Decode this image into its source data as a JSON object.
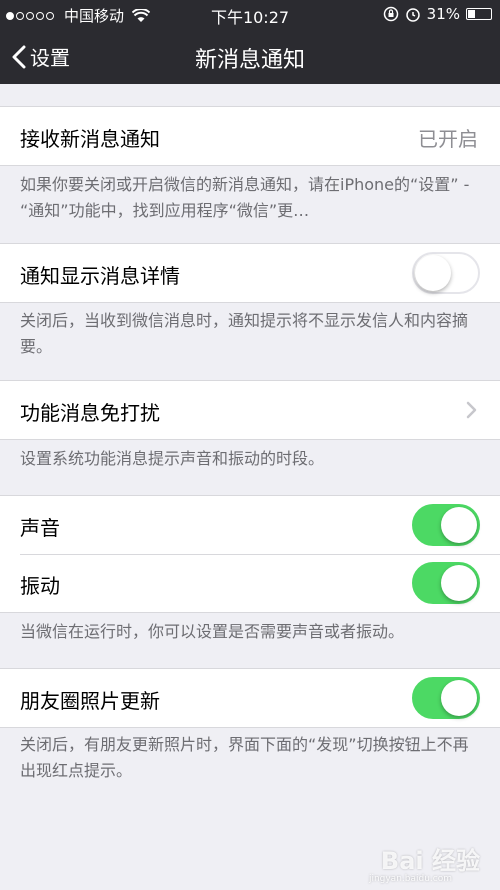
{
  "status_bar": {
    "carrier": "中国移动",
    "time": "下午10:27",
    "battery": "31%",
    "battery_level": 0.31,
    "icons": [
      "signal-dots-icon",
      "wifi-icon",
      "rotation-lock-icon",
      "alarm-icon",
      "battery-icon"
    ]
  },
  "nav": {
    "back_label": "设置",
    "title": "新消息通知"
  },
  "sections": {
    "receive": {
      "label": "接收新消息通知",
      "value": "已开启",
      "note": "如果你要关闭或开启微信的新消息通知，请在iPhone的“设置” - “通知”功能中，找到应用程序“微信”更…"
    },
    "details": {
      "label": "通知显示消息详情",
      "toggle_on": false,
      "note": "关闭后，当收到微信消息时，通知提示将不显示发信人和内容摘要。"
    },
    "dnd": {
      "label": "功能消息免打扰",
      "note": "设置系统功能消息提示声音和振动的时段。"
    },
    "sound": {
      "label": "声音",
      "toggle_on": true
    },
    "vibration": {
      "label": "振动",
      "toggle_on": true,
      "note": "当微信在运行时，你可以设置是否需要声音或者振动。"
    },
    "moments": {
      "label": "朋友圈照片更新",
      "toggle_on": true,
      "note": "关闭后，有朋友更新照片时，界面下面的“发现”切换按钮上不再出现红点提示。"
    }
  },
  "watermark": {
    "text": "Bai 经验",
    "sub": "jingyan.baidu.com"
  },
  "colors": {
    "toggle_on": "#4cd964",
    "nav_bg": "#2b2b30",
    "page_bg": "#efeff4"
  }
}
